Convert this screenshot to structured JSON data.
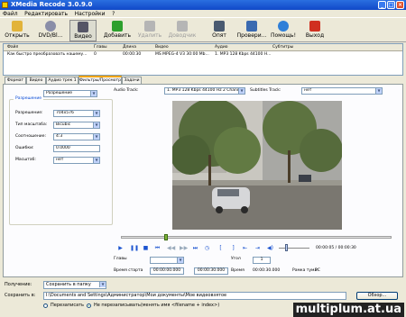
{
  "window": {
    "title": "XMedia Recode 3.0.9.0"
  },
  "menu": [
    "Файл",
    "Редактировать",
    "Настройки",
    "?"
  ],
  "toolbar": {
    "items": [
      {
        "label": "Открыть",
        "icon": "folder-open-icon",
        "color": "#e2b33a"
      },
      {
        "label": "DVD/Bl...",
        "icon": "disc-icon",
        "color": "#8a8ea8"
      },
      {
        "label": "Видео",
        "icon": "video-icon",
        "color": "#555566"
      },
      {
        "label": "Добавить",
        "icon": "add-icon",
        "color": "#2da02d"
      },
      {
        "label": "Удалить",
        "icon": "remove-icon",
        "color": "#b5b5b5"
      },
      {
        "label": "Доводчик",
        "icon": "edit-icon",
        "color": "#b5b5b5"
      },
      {
        "label": "Опят",
        "icon": "encode-icon",
        "color": "#4a5a70"
      },
      {
        "label": "Провери...",
        "icon": "check-icon",
        "color": "#3a6ab0"
      },
      {
        "label": "Помощь!",
        "icon": "help-icon",
        "color": "#2f7fd8"
      },
      {
        "label": "Выход",
        "icon": "exit-icon",
        "color": "#d03020"
      }
    ]
  },
  "filelist": {
    "headers": [
      "Файл",
      "Главы",
      "Длина",
      "Видео",
      "Аудио",
      "Субтитры"
    ],
    "rows": [
      {
        "file": "Как быстро преобразовать нашему...",
        "chapters": "0",
        "length": "00:00:30",
        "video": "MS MPEG-4 V3 30:00 Mb...",
        "audio": "1. MP3 128 Kbps 44100 H...",
        "subs": ""
      }
    ]
  },
  "tabs": [
    "Формат",
    "Видео",
    "Аудио трек 1",
    "Фильтры/Просмотр",
    "Задачи"
  ],
  "active_tab_index": 3,
  "filter": {
    "mode": "Разрешение",
    "group_title": "Разрешение",
    "fields": [
      {
        "label": "Разрешение:",
        "value": "704x576"
      },
      {
        "label": "Тип масштаба:",
        "value": "Bicubic"
      },
      {
        "label": "Соотношение:",
        "value": "4:3"
      },
      {
        "label": "Ошибки:",
        "value": "0.0000"
      },
      {
        "label": "Масштаб:",
        "value": "нет"
      }
    ]
  },
  "audio_track": {
    "label": "Audio Track:",
    "value": "1. MP3 128 Kbps 44100 Hz 2 Channel"
  },
  "subtitles_track": {
    "label": "Subtitles Track:",
    "value": "нет"
  },
  "time_display": "00:00:05 / 00:00:30",
  "seek_progress": 0.16,
  "chapters": {
    "label": "Главы",
    "value": ""
  },
  "angle": {
    "label": "Угол",
    "value": "1"
  },
  "trim": {
    "start_label": "Время старта",
    "start_value": "00:00:00.000",
    "end_value": "00:00:30.000",
    "time_label": "Время",
    "time_value": "00:00:30.000",
    "frame_label": "Рамка тума:",
    "frame_value": "PC"
  },
  "output": {
    "mode_label": "Получение:",
    "mode_value": "Сохранить в папку",
    "save_label": "Сохранить в:",
    "save_value": "I:\\Documents and Settings\\Администратор\\Мои документы\\Мое видеовзятое",
    "browse_label": "Обзор...",
    "radio_overwrite": "Перезаписать",
    "radio_no_overwrite": "Не перезаписывать(менять имя <filename + index>)"
  },
  "watermark": "multiplum.at.ua"
}
